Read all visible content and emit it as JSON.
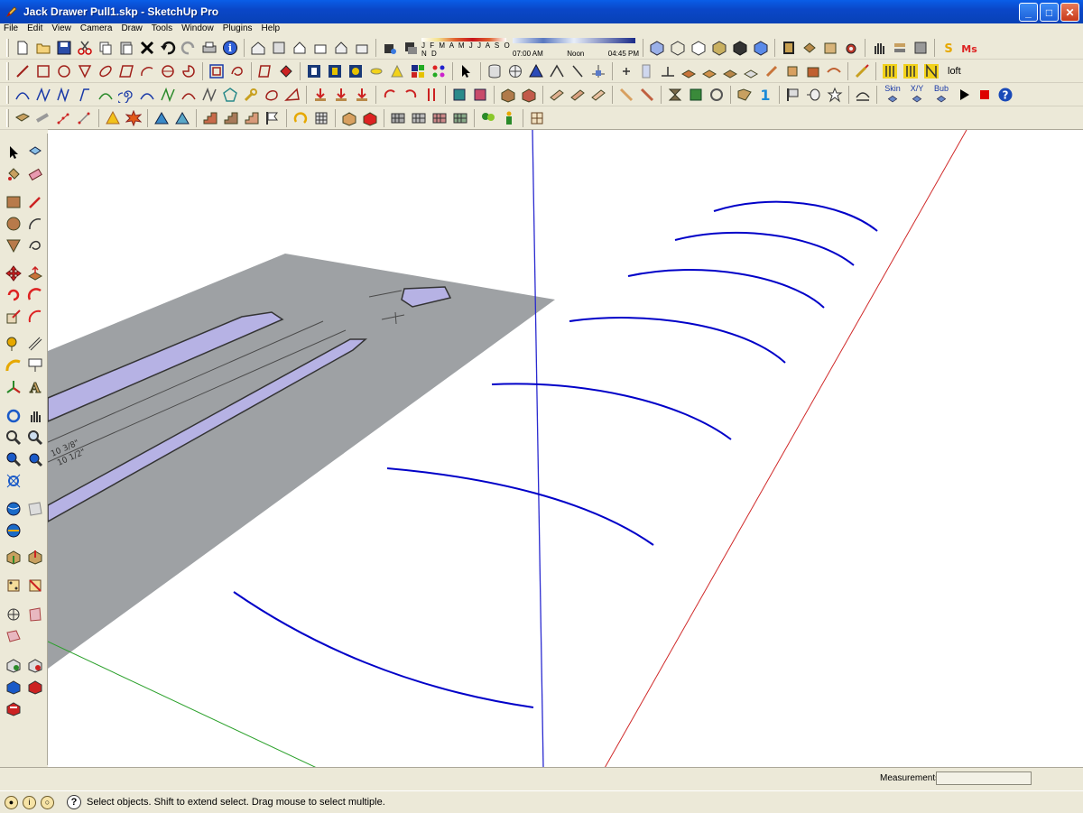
{
  "window": {
    "title": "Jack Drawer Pull1.skp - SketchUp Pro",
    "app_icon": "sketchup-pencil-icon",
    "buttons": [
      "_",
      "□",
      "✕"
    ]
  },
  "menu": {
    "items": [
      "File",
      "Edit",
      "View",
      "Camera",
      "Draw",
      "Tools",
      "Window",
      "Plugins",
      "Help"
    ]
  },
  "shadow_settings": {
    "months": "J F M A M J J A S O N D",
    "time_start": "07:00 AM",
    "time_mid": "Noon",
    "time_end": "04:45 PM"
  },
  "toolbar_text": {
    "loft": "loft",
    "skin": "Skin",
    "xy": "X/Y",
    "bub": "Bub"
  },
  "colors": {
    "curve_blue": "#0000c8",
    "axis_red": "#d22",
    "axis_green": "#2a2",
    "axis_blue": "#22c",
    "sketch_plane": "#9a9da0",
    "sketch_fill": "#b8b4e6"
  },
  "viewport": {
    "dimension_labels": [
      "10 3/8\"",
      "10 1/2\""
    ]
  },
  "status": {
    "measurements_label": "Measurements",
    "measurements_value": "",
    "message": "Select objects. Shift to extend select. Drag mouse to select multiple."
  }
}
